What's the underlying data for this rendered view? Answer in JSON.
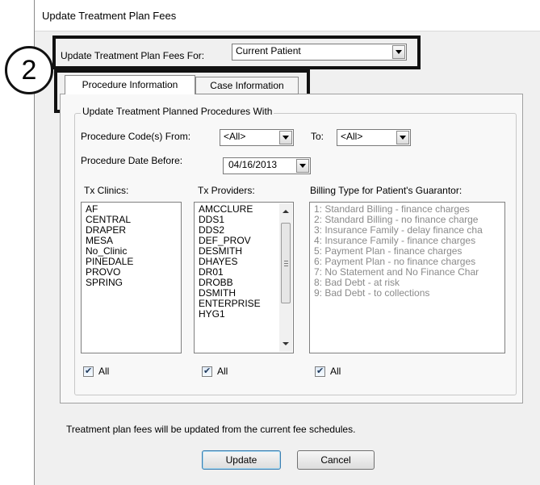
{
  "window": {
    "title": "Update Treatment Plan Fees"
  },
  "top": {
    "label": "Update Treatment Plan Fees For:",
    "selected": "Current Patient"
  },
  "annotation": {
    "number": "2"
  },
  "tabs": [
    {
      "label": "Procedure Information",
      "active": true
    },
    {
      "label": "Case Information",
      "active": false
    }
  ],
  "group": {
    "title": "Update Treatment Planned Procedures With",
    "proc_from_label": "Procedure Code(s) From:",
    "proc_from_value": "<All>",
    "to_label": "To:",
    "to_value": "<All>",
    "date_label": "Procedure Date Before:",
    "date_value": "04/16/2013"
  },
  "lists": {
    "clinics": {
      "header": "Tx Clinics:",
      "items": [
        "AF",
        "CENTRAL",
        "DRAPER",
        "MESA",
        "No_Clinic",
        "PINEDALE",
        "PROVO",
        "SPRING"
      ],
      "all_label": "All",
      "all_checked": true
    },
    "providers": {
      "header": "Tx Providers:",
      "items": [
        "AMCCLURE",
        "DDS1",
        "DDS2",
        "DEF_PROV",
        "DESMITH",
        "DHAYES",
        "DR01",
        "DROBB",
        "DSMITH",
        "ENTERPRISE",
        "HYG1"
      ],
      "all_label": "All",
      "all_checked": true
    },
    "billing": {
      "header": "Billing Type for Patient's Guarantor:",
      "items": [
        "1: Standard Billing - finance charges",
        "2: Standard Billing - no finance charge",
        "3: Insurance Family - delay finance cha",
        "4: Insurance Family - finance charges",
        "5: Payment Plan - finance charges",
        "6: Payment Plan - no finance charges",
        "7: No Statement and No Finance Char",
        "8: Bad Debt - at risk",
        "9: Bad Debt - to collections"
      ],
      "all_label": "All",
      "all_checked": true
    }
  },
  "footer": {
    "note": "Treatment plan fees will be updated from the current fee schedules.",
    "update_label": "Update",
    "cancel_label": "Cancel"
  }
}
